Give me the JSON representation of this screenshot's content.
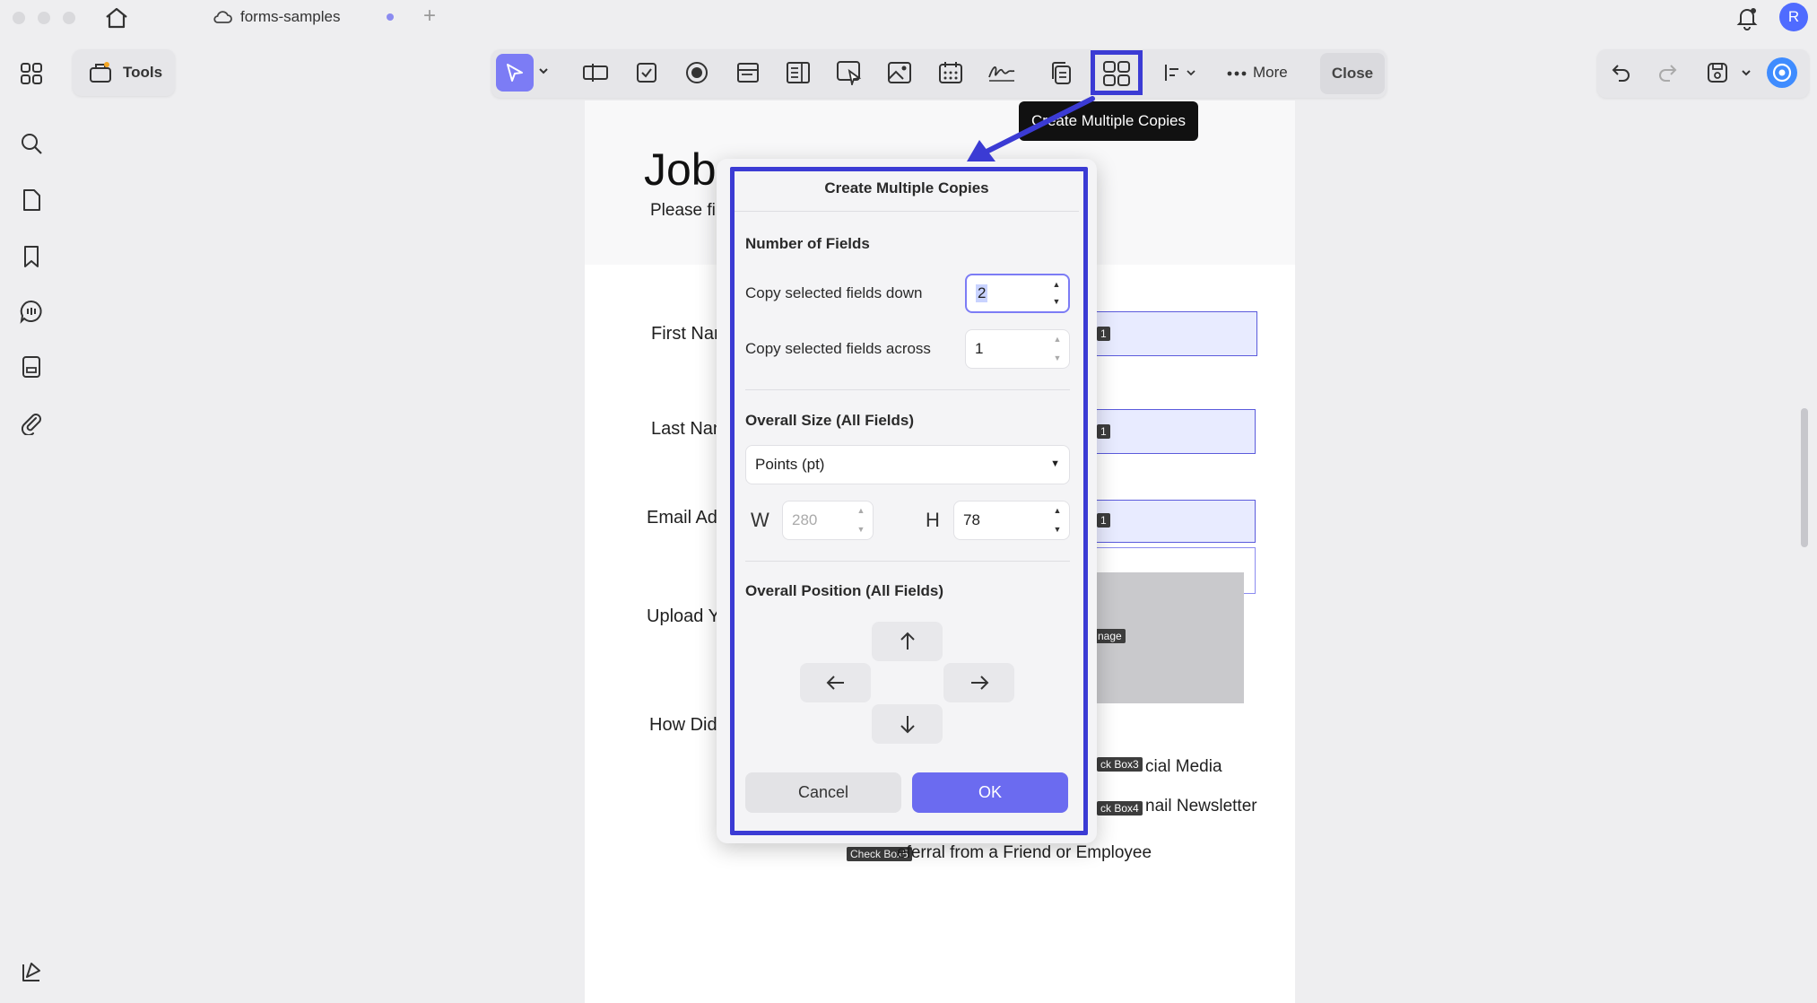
{
  "window": {
    "tab_title": "forms-samples",
    "new_tab_symbol": "+",
    "avatar_initial": "R"
  },
  "sidebar": {
    "tools_label": "Tools"
  },
  "toolbar": {
    "more_label": "More",
    "close_label": "Close",
    "tooltip": "Create Multiple Copies"
  },
  "document": {
    "title": "Job",
    "intro": "Please fil",
    "labels": {
      "first_name": "First Nan",
      "last_name": "Last Nan",
      "email": "Email Add",
      "upload": "Upload Y",
      "how_did": "How Did"
    },
    "field_tags": {
      "first": "1",
      "last": "1",
      "email": "1",
      "image": "nage",
      "checkbox3": "ck Box3",
      "checkbox4": "ck Box4",
      "checkbox5": "Check Box5"
    },
    "options": {
      "social": "cial Media",
      "newsletter": "nail Newsletter",
      "referral": "eferral from a Friend or Employee"
    }
  },
  "dialog": {
    "title": "Create Multiple Copies",
    "number_of_fields": "Number of Fields",
    "copy_down_label": "Copy selected fields down",
    "copy_down_value": "2",
    "copy_across_label": "Copy selected fields across",
    "copy_across_value": "1",
    "overall_size": "Overall Size (All Fields)",
    "unit_selected": "Points (pt)",
    "w_label": "W",
    "w_value": "280",
    "h_label": "H",
    "h_value": "78",
    "overall_position": "Overall Position (All Fields)",
    "cancel_label": "Cancel",
    "ok_label": "OK"
  },
  "colors": {
    "accent": "#6b6bf0",
    "highlight_frame": "#3b3bd4",
    "ok_button": "#6b6bf0"
  },
  "icons": [
    "home-icon",
    "cloud-icon",
    "grid-icon",
    "search-icon",
    "page-icon",
    "bookmark-icon",
    "comment-icon",
    "form-icon",
    "paperclip-icon",
    "layers-icon",
    "bell-icon",
    "undo-icon",
    "redo-icon",
    "save-icon",
    "ai-icon"
  ]
}
